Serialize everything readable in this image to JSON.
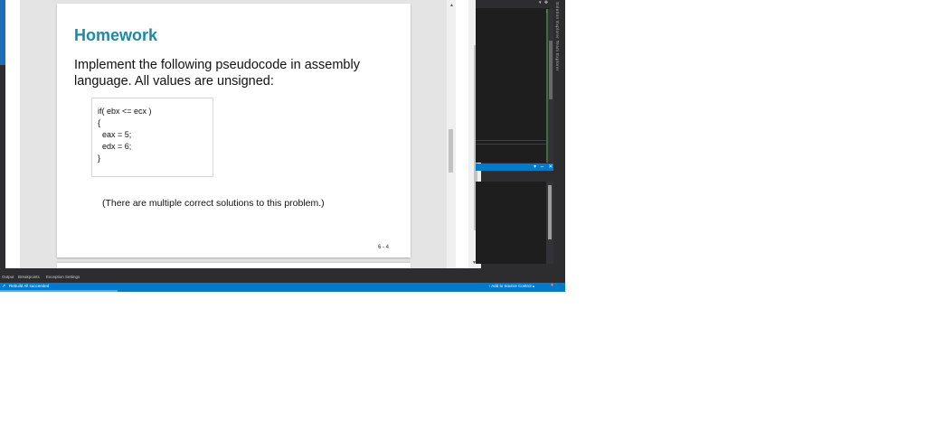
{
  "slide": {
    "title": "Homework",
    "text": "Implement the following pseudocode in assembly language. All values are unsigned:",
    "code": [
      "if( ebx <= ecx )",
      "{",
      "  eax = 5;",
      "  edx = 6;",
      "}"
    ],
    "note": "(There are multiple correct solutions to this problem.)",
    "page_number": "6 - 4"
  },
  "bottom_tabs": [
    "Output",
    "Breakpoints",
    "Exception Settings"
  ],
  "status_bar": {
    "icon": "↗",
    "text": "Rebuild All succeeded",
    "source_control": "↑  Add to Source Control  ▴"
  },
  "side_panel": {
    "tab_text": "Solution Explorer   Team Explorer",
    "controls_top": "▾ ✥",
    "controls_panel": "▾ ⇔ ✕"
  },
  "colors": {
    "accent": "#007acc",
    "title": "#1a8aa6",
    "dark_bg": "#1e1e1e",
    "chrome": "#2d2d30"
  }
}
